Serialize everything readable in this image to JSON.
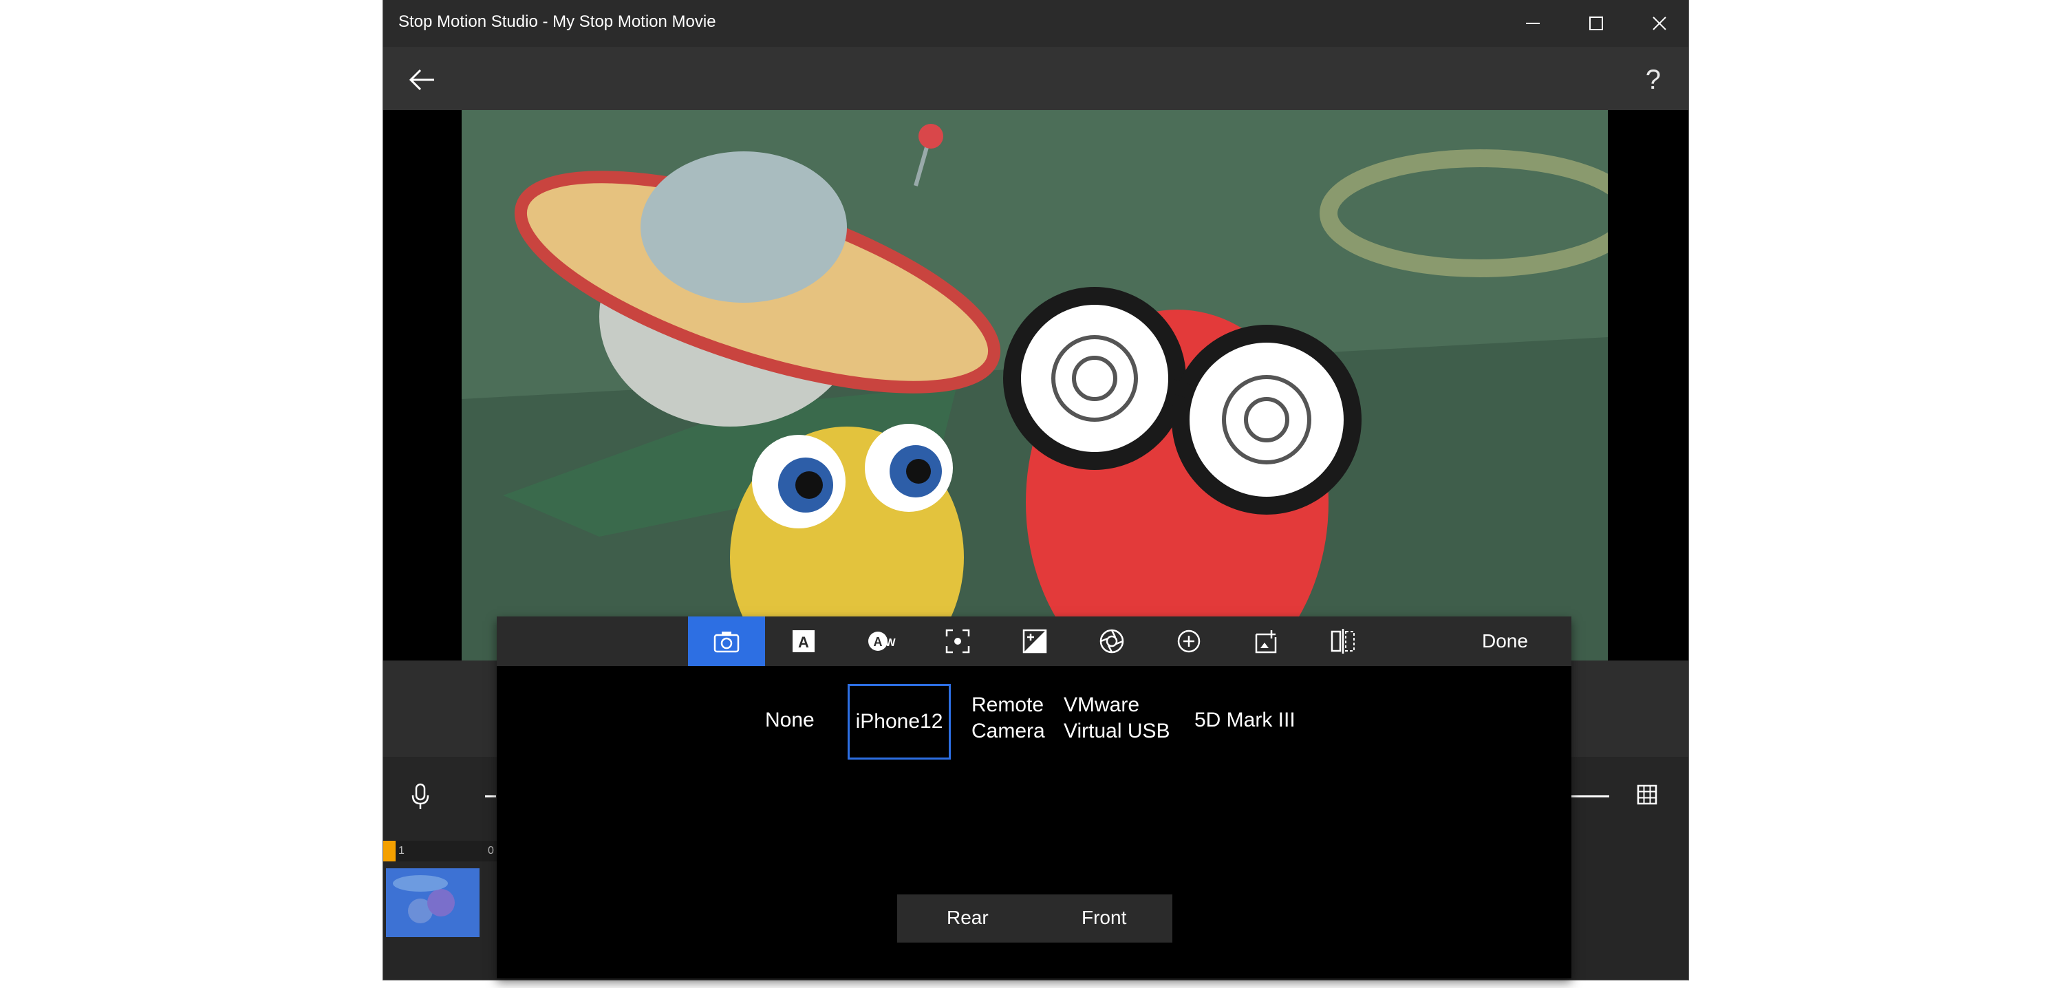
{
  "window": {
    "title": "Stop Motion Studio - My Stop Motion Movie"
  },
  "appbar": {
    "back_icon": "arrow-left-icon",
    "help_label": "?"
  },
  "timeline": {
    "frame_start": "1",
    "frame_end": "0"
  },
  "camera_panel": {
    "tools": [
      {
        "icon": "camera-icon",
        "active": true
      },
      {
        "icon": "auto-focus-text-icon",
        "active": false
      },
      {
        "icon": "white-balance-icon",
        "active": false
      },
      {
        "icon": "focus-frame-icon",
        "active": false
      },
      {
        "icon": "exposure-icon",
        "active": false
      },
      {
        "icon": "aperture-icon",
        "active": false
      },
      {
        "icon": "zoom-in-icon",
        "active": false
      },
      {
        "icon": "import-image-icon",
        "active": false
      },
      {
        "icon": "mirror-icon",
        "active": false
      }
    ],
    "done_label": "Done",
    "sources": [
      {
        "label": "None",
        "selected": false
      },
      {
        "label": "iPhone12",
        "selected": true
      },
      {
        "label": "Remote\nCamera",
        "selected": false
      },
      {
        "label": "VMware\nVirtual USB",
        "selected": false
      },
      {
        "label": "5D Mark III",
        "selected": false
      }
    ],
    "lens_options": [
      "Rear",
      "Front"
    ]
  },
  "colors": {
    "accent": "#2d6fe3",
    "playhead": "#f4a000",
    "background": "#2b2b2b"
  }
}
